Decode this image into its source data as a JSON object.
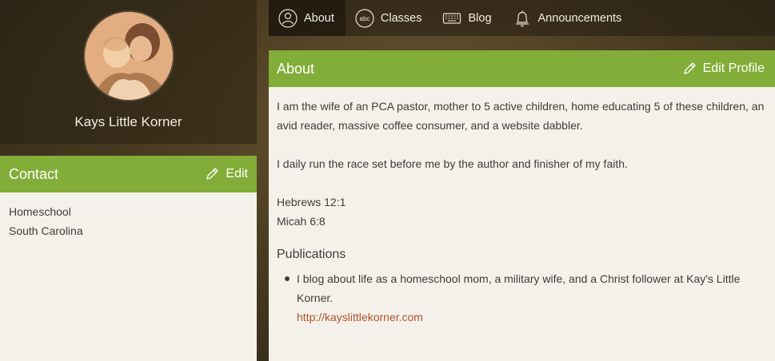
{
  "profile": {
    "name": "Kays Little Korner",
    "avatar_icon": "profile-photo"
  },
  "contact": {
    "title": "Contact",
    "edit_label": "Edit",
    "items": [
      "Homeschool",
      "South Carolina"
    ]
  },
  "nav": {
    "tabs": [
      {
        "label": "About",
        "icon": "user-icon",
        "active": true
      },
      {
        "label": "Classes",
        "icon": "abc-icon",
        "active": false
      },
      {
        "label": "Blog",
        "icon": "keyboard-icon",
        "active": false
      },
      {
        "label": "Announcements",
        "icon": "bell-icon",
        "active": false
      }
    ]
  },
  "about": {
    "title": "About",
    "edit_label": "Edit Profile",
    "paragraphs": [
      "I am the wife of an PCA pastor, mother to 5 active children, home educating 5 of these children, an avid reader, massive coffee consumer, and a website dabbler.",
      "I daily run the race set before me by the author and finisher of my faith."
    ],
    "verses": [
      "Hebrews 12:1",
      "Micah 6:8"
    ],
    "publications_heading": "Publications",
    "publications": [
      {
        "text": "I blog about life as a homeschool mom, a military wife, and a Christ follower at Kay's Little Korner.",
        "link": "http://kayslittlekorner.com"
      }
    ]
  },
  "colors": {
    "accent_green": "#82ad38",
    "link": "#b0542b",
    "panel_bg": "#f4f1ea"
  }
}
